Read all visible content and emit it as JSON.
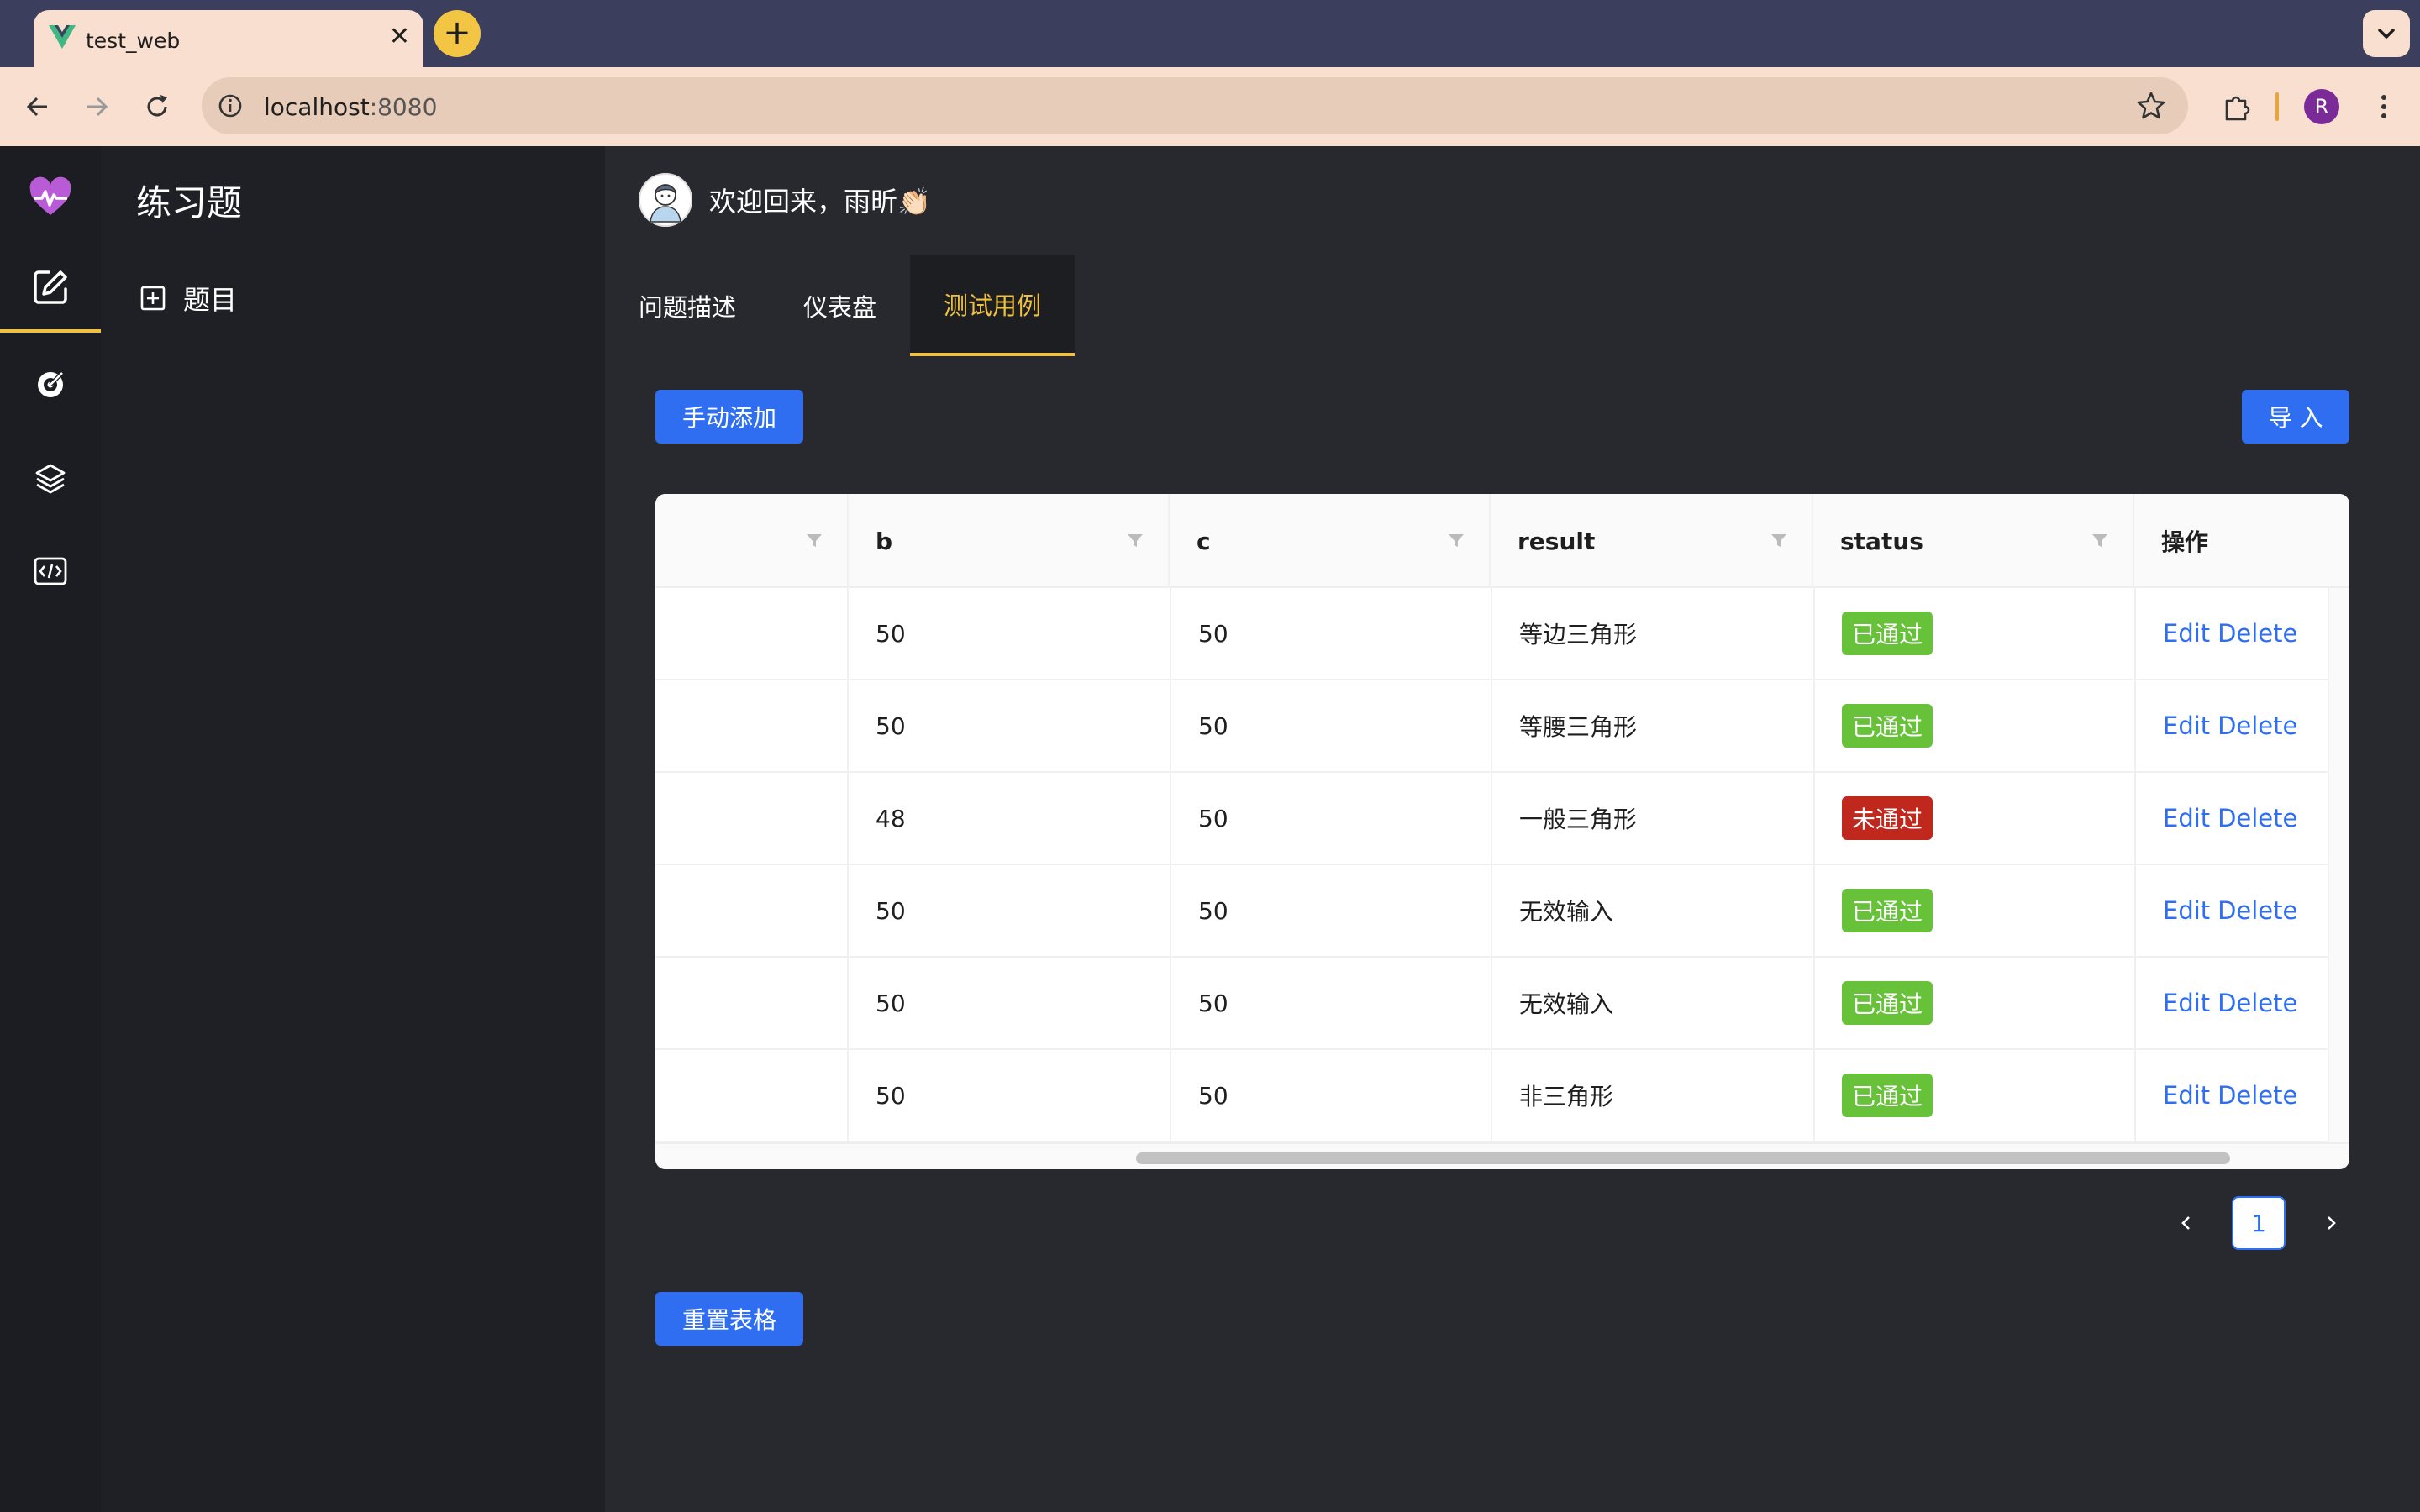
{
  "browser": {
    "tab_title": "test_web",
    "tab_close": "✕",
    "new_tab": "+",
    "url_host": "localhost",
    "url_port": ":8080",
    "profile_initial": "R"
  },
  "app": {
    "sidebar": {
      "title": "练习题",
      "item_label": "题目"
    },
    "welcome": "欢迎回来，雨昕👏🏻",
    "tabs": [
      {
        "label": "问题描述",
        "active": false
      },
      {
        "label": "仪表盘",
        "active": false
      },
      {
        "label": "测试用例",
        "active": true
      }
    ],
    "add_button": "手动添加",
    "import_button": "导 入",
    "reset_button": "重置表格",
    "table": {
      "columns": [
        "",
        "b",
        "c",
        "result",
        "status",
        "操作"
      ],
      "rows": [
        {
          "a": "",
          "b": "50",
          "c": "50",
          "result": "等边三角形",
          "status": "已通过",
          "passed": true
        },
        {
          "a": "",
          "b": "50",
          "c": "50",
          "result": "等腰三角形",
          "status": "已通过",
          "passed": true
        },
        {
          "a": "",
          "b": "48",
          "c": "50",
          "result": "一般三角形",
          "status": "未通过",
          "passed": false
        },
        {
          "a": "",
          "b": "50",
          "c": "50",
          "result": "无效输入",
          "status": "已通过",
          "passed": true
        },
        {
          "a": "",
          "b": "50",
          "c": "50",
          "result": "无效输入",
          "status": "已通过",
          "passed": true
        },
        {
          "a": "",
          "b": "50",
          "c": "50",
          "result": "非三角形",
          "status": "已通过",
          "passed": true
        }
      ],
      "edit_label": "Edit",
      "delete_label": "Delete"
    },
    "pagination": {
      "current": "1"
    }
  },
  "colors": {
    "accent": "#f0c040",
    "primary": "#2f6ef0",
    "pass": "#67c23a",
    "fail": "#c0281e"
  }
}
